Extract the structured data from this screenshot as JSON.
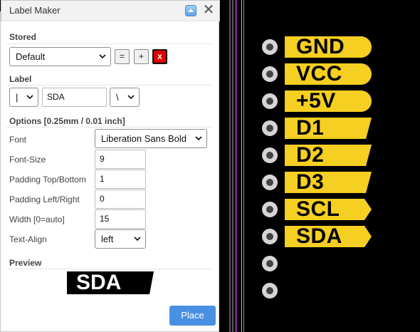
{
  "dialog": {
    "title": "Label Maker",
    "stored": {
      "section_title": "Stored",
      "selected": "Default",
      "apply_label": "=",
      "add_label": "+",
      "delete_label": "x"
    },
    "label": {
      "section_title": "Label",
      "prefix_selected": "|",
      "text_value": "SDA",
      "suffix_selected": "\\"
    },
    "options": {
      "section_title": "Options [0.25mm / 0.01 inch]",
      "font_label": "Font",
      "font_selected": "Liberation Sans Bold",
      "font_size_label": "Font-Size",
      "font_size_value": "9",
      "padding_tb_label": "Padding Top/Bottom",
      "padding_tb_value": "1",
      "padding_lr_label": "Padding Left/Right",
      "padding_lr_value": "0",
      "width_label": "Width [0=auto]",
      "width_value": "15",
      "text_align_label": "Text-Align",
      "text_align_selected": "left"
    },
    "preview": {
      "section_title": "Preview",
      "text": "SDA"
    },
    "place_label": "Place"
  },
  "canvas": {
    "labels": [
      {
        "text": "GND",
        "shape": "round"
      },
      {
        "text": "VCC",
        "shape": "round"
      },
      {
        "text": "+5V",
        "shape": "round"
      },
      {
        "text": "D1",
        "shape": "slant"
      },
      {
        "text": "D2",
        "shape": "slant"
      },
      {
        "text": "D3",
        "shape": "slant"
      },
      {
        "text": "SCL",
        "shape": "arrow"
      },
      {
        "text": "SDA",
        "shape": "arrow"
      }
    ],
    "pin_count": 10,
    "colors": {
      "background": "#000000",
      "label_fill": "#f5cf22",
      "track_purple": "#7a1f8f",
      "pad": "#d6d6d6",
      "accent_button": "#4a90e2"
    }
  }
}
